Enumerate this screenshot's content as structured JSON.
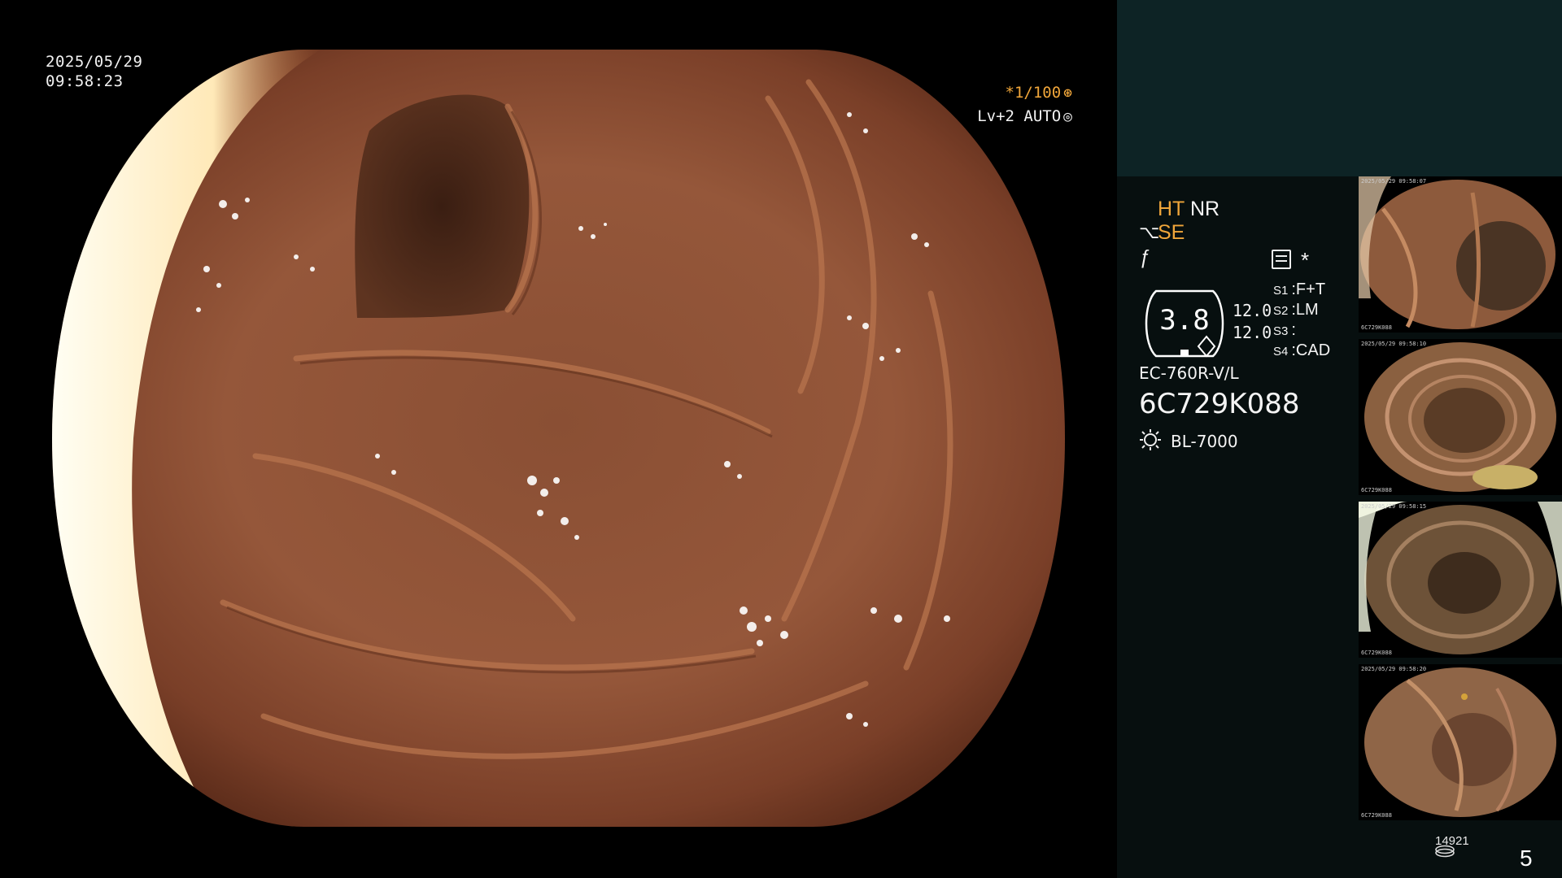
{
  "overlay": {
    "date": "2025/05/29",
    "time": "09:58:23",
    "shutter": "*1/100",
    "iris_mode": "Lv+2 AUTO"
  },
  "status": {
    "enh_top_left": "HT",
    "enh_top_right": "NR",
    "structure_enhance": "SE",
    "zoom_display": "3.8",
    "value_a": "12.0",
    "value_b": "12.0",
    "switches": [
      {
        "label": "S1",
        "value": "F+T"
      },
      {
        "label": "S2",
        "value": "LM"
      },
      {
        "label": "S3",
        "value": ""
      },
      {
        "label": "S4",
        "value": "CAD"
      }
    ],
    "scope_model": "EC-760R-V/L",
    "serial": "6C729K088",
    "light_source": "BL-7000"
  },
  "thumbnails": [
    {
      "caption_top": "2025/05/29 09:58:07",
      "caption_bottom": "6C729K088"
    },
    {
      "caption_top": "2025/05/29 09:58:10",
      "caption_bottom": "6C729K088"
    },
    {
      "caption_top": "2025/05/29 09:58:15",
      "caption_bottom": "6C729K088"
    },
    {
      "caption_top": "2025/05/29 09:58:20",
      "caption_bottom": "6C729K088"
    }
  ],
  "storage": {
    "remaining": "14921",
    "captured": "5"
  },
  "colors": {
    "accent": "#f0a63a",
    "panel_top": "#0d2325",
    "panel": "#070f0f"
  }
}
